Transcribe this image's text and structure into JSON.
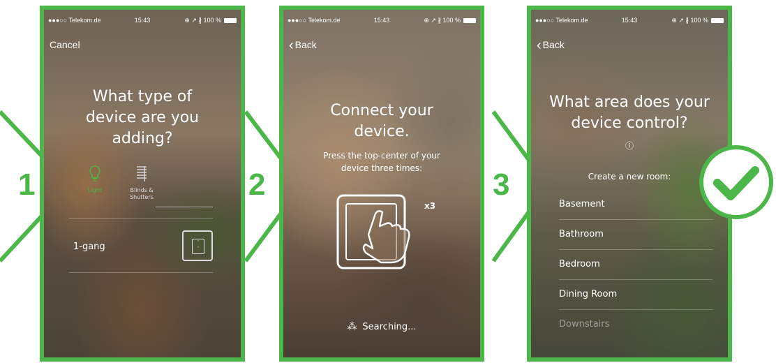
{
  "status": {
    "carrier": "●●●○○ Telekom.de",
    "time": "15:43",
    "battery": "100 %",
    "icons": "⊕ ↗ ∦"
  },
  "colors": {
    "accent": "#4bb748"
  },
  "steps": [
    "1",
    "2",
    "3"
  ],
  "screen1": {
    "cancel": "Cancel",
    "title": "What type of device are you adding?",
    "type_light": "Light",
    "type_blinds": "Blinds & Shutters",
    "gang": "1-gang",
    "icons": {
      "light": "lightbulb-icon",
      "blinds": "blinds-icon",
      "switch": "switch-icon"
    }
  },
  "screen2": {
    "back": "Back",
    "title": "Connect your device.",
    "instruction": "Press the top-center of your device three times:",
    "times": "x3",
    "searching": "Searching...",
    "icons": {
      "hand": "hand-tap-icon",
      "spinner": "spinner-icon"
    }
  },
  "screen3": {
    "back": "Back",
    "title": "What area does your device control?",
    "info": "ⓘ",
    "create": "Create a new room:",
    "rooms": [
      "Basement",
      "Bathroom",
      "Bedroom",
      "Dining Room",
      "Downstairs"
    ]
  }
}
